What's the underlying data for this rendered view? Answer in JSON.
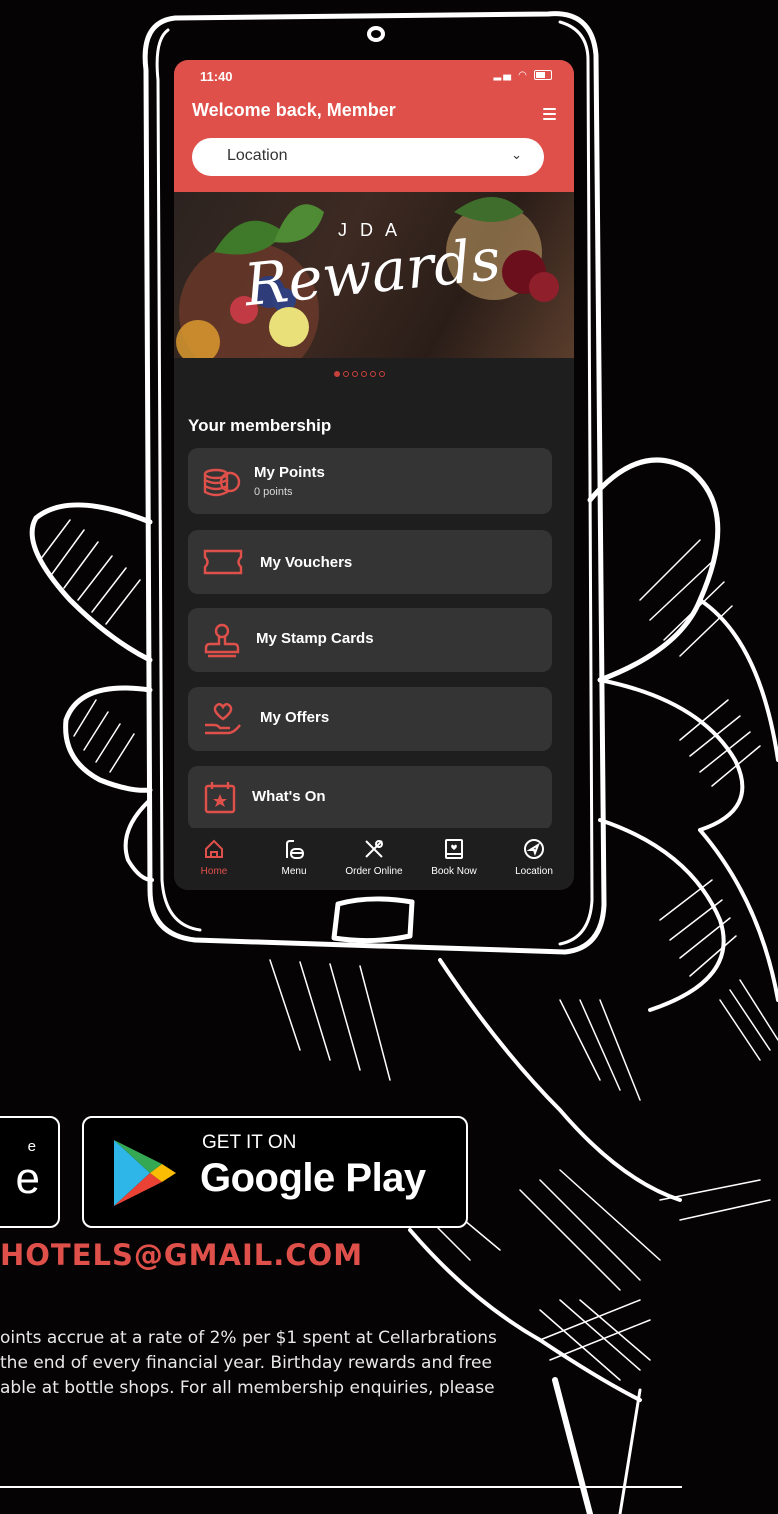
{
  "status_bar": {
    "time": "11:40"
  },
  "header": {
    "welcome": "Welcome back, Member",
    "location_label": "Location"
  },
  "banner": {
    "brand_letters": "J D A",
    "brand_script": "Rewards",
    "slides": 6,
    "active_slide": 1
  },
  "membership": {
    "title": "Your membership",
    "items": [
      {
        "title": "My Points",
        "subtitle": "0 points",
        "icon": "coins-icon"
      },
      {
        "title": "My Vouchers",
        "icon": "ticket-icon"
      },
      {
        "title": "My Stamp Cards",
        "icon": "stamp-icon"
      },
      {
        "title": "My Offers",
        "icon": "hand-heart-icon"
      },
      {
        "title": "What's On",
        "icon": "calendar-star-icon"
      }
    ]
  },
  "tabs": [
    {
      "label": "Home",
      "icon": "home-icon",
      "active": true
    },
    {
      "label": "Menu",
      "icon": "menu-icon",
      "active": false
    },
    {
      "label": "Order Online",
      "icon": "utensils-icon",
      "active": false
    },
    {
      "label": "Book Now",
      "icon": "book-icon",
      "active": false
    },
    {
      "label": "Location",
      "icon": "compass-icon",
      "active": false
    }
  ],
  "stores": {
    "apple_small": "e",
    "apple_big": "e",
    "google_small": "GET IT ON",
    "google_big": "Google Play"
  },
  "footer": {
    "email": "HOTELS@GMAIL.COM",
    "fine_print": [
      "oints accrue at a rate of 2% per $1 spent at Cellarbrations",
      "the end of every financial year. Birthday rewards and free",
      "able at bottle shops. For all membership enquiries, please"
    ]
  },
  "colors": {
    "accent": "#e0504a",
    "background": "#050303",
    "app_bg": "#1f1e1f",
    "card_bg": "#353435"
  }
}
